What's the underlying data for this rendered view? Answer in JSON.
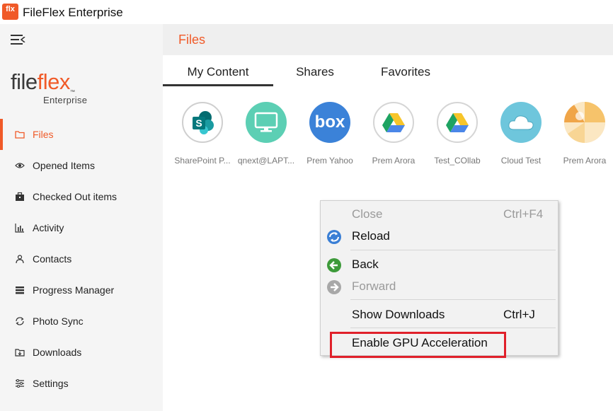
{
  "window": {
    "title": "FileFlex Enterprise",
    "icon_text": "flx"
  },
  "sidebar": {
    "logo": {
      "part1": "file",
      "part2": "flex",
      "tm": "™",
      "subtitle": "Enterprise"
    },
    "items": [
      {
        "label": "Files",
        "icon": "folder-icon",
        "active": true
      },
      {
        "label": "Opened Items",
        "icon": "eye-icon"
      },
      {
        "label": "Checked Out items",
        "icon": "briefcase-icon"
      },
      {
        "label": "Activity",
        "icon": "bar-chart-icon"
      },
      {
        "label": "Contacts",
        "icon": "person-icon"
      },
      {
        "label": "Progress Manager",
        "icon": "stack-icon"
      },
      {
        "label": "Photo Sync",
        "icon": "sync-icon"
      },
      {
        "label": "Downloads",
        "icon": "download-folder-icon"
      },
      {
        "label": "Settings",
        "icon": "sliders-icon"
      }
    ]
  },
  "header": {
    "title": "Files"
  },
  "tabs": [
    {
      "label": "My Content",
      "active": true
    },
    {
      "label": "Shares"
    },
    {
      "label": "Favorites"
    }
  ],
  "sources": [
    {
      "label": "SharePoint P...",
      "icon": "sharepoint-icon"
    },
    {
      "label": "qnext@LAPT...",
      "icon": "monitor-icon"
    },
    {
      "label": "Prem Yahoo",
      "icon": "box-icon",
      "icon_text": "box"
    },
    {
      "label": "Prem Arora",
      "icon": "google-drive-icon"
    },
    {
      "label": "Test_COllab",
      "icon": "google-drive-icon"
    },
    {
      "label": "Cloud Test",
      "icon": "cloud-icon"
    },
    {
      "label": "Prem Arora",
      "icon": "beach-ball-icon"
    }
  ],
  "context_menu": {
    "items": [
      {
        "label": "Close",
        "shortcut": "Ctrl+F4",
        "disabled": true
      },
      {
        "label": "Reload",
        "shortcut": "",
        "icon": "reload-icon"
      },
      {
        "label": "Back",
        "shortcut": "",
        "icon": "back-arrow-icon"
      },
      {
        "label": "Forward",
        "shortcut": "",
        "icon": "forward-arrow-icon",
        "disabled": true
      },
      {
        "label": "Show Downloads",
        "shortcut": "Ctrl+J"
      },
      {
        "label": "Enable GPU Acceleration",
        "shortcut": ""
      }
    ]
  },
  "colors": {
    "accent": "#f05a28",
    "highlight_box": "#e0202a",
    "sidebar_bg": "#f5f5f5",
    "header_bg": "#efefef"
  }
}
